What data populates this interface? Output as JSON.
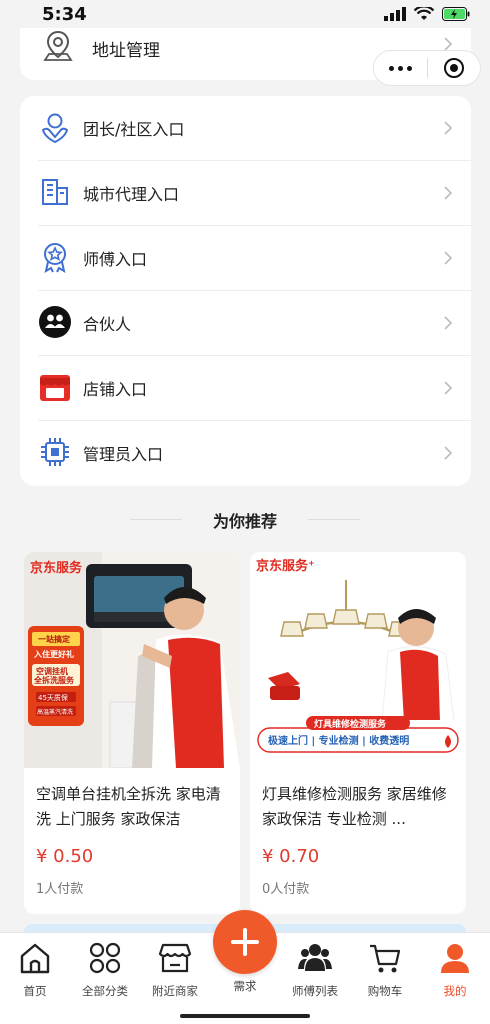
{
  "status_bar": {
    "time": "5:34"
  },
  "address": {
    "label": "地址管理"
  },
  "menu": {
    "items": [
      {
        "label": "团长/社区入口",
        "icon": "person-heart-icon"
      },
      {
        "label": "城市代理入口",
        "icon": "building-icon"
      },
      {
        "label": "师傅入口",
        "icon": "badge-star-icon"
      },
      {
        "label": "合伙人",
        "icon": "partners-icon"
      },
      {
        "label": "店铺入口",
        "icon": "store-icon"
      },
      {
        "label": "管理员入口",
        "icon": "chip-icon"
      }
    ]
  },
  "recommend": {
    "title": "为你推荐",
    "products": [
      {
        "brand": "京东服务",
        "badge_lines": [
          "一站搞定",
          "入住更好礼",
          "空调挂机",
          "全拆洗服务",
          "45天质保",
          "高温蒸汽清洗",
          "不满意重洗"
        ],
        "title": "空调单台挂机全拆洗 家电清洗 上门服务 家政保洁",
        "price": "¥ 0.50",
        "sold": "1人付款"
      },
      {
        "brand": "京东服务",
        "banner_title": "灯具维修检测服务",
        "banner_sub": "极速上门 | 专业检测 | 收费透明",
        "title": "灯具维修检测服务 家居维修 家政保洁 专业检测 ...",
        "price": "¥ 0.70",
        "sold": "0人付款"
      }
    ]
  },
  "tabbar": {
    "tabs": [
      {
        "label": "首页",
        "icon": "home-icon"
      },
      {
        "label": "全部分类",
        "icon": "grid-icon"
      },
      {
        "label": "附近商家",
        "icon": "shop-icon"
      },
      {
        "label": "需求",
        "icon": "plus-icon"
      },
      {
        "label": "师傅列表",
        "icon": "workers-icon"
      },
      {
        "label": "购物车",
        "icon": "cart-icon"
      },
      {
        "label": "我的",
        "icon": "user-icon"
      }
    ],
    "active": "我的"
  },
  "colors": {
    "accent": "#f05a2a",
    "price": "#e23a2e",
    "menu_icon": "#3f6fd1"
  }
}
